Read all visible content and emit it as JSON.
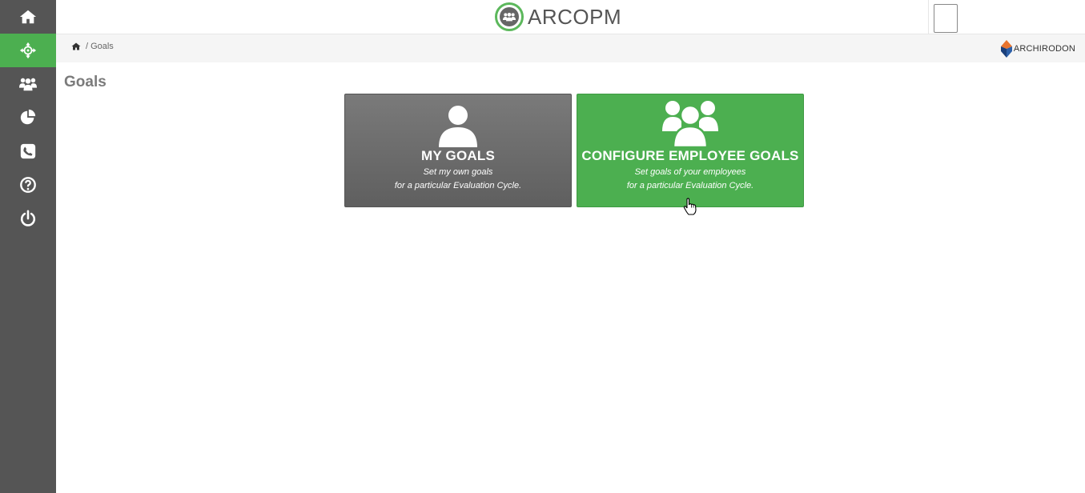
{
  "app": {
    "brand": "ARCOPM",
    "company": "ARCHIRODON"
  },
  "sidebar": {
    "items": [
      {
        "icon": "home-icon",
        "active": false
      },
      {
        "icon": "crosshair-icon",
        "active": true
      },
      {
        "icon": "users-icon",
        "active": false
      },
      {
        "icon": "pie-chart-icon",
        "active": false
      },
      {
        "icon": "phone-icon",
        "active": false
      },
      {
        "icon": "help-icon",
        "active": false
      },
      {
        "icon": "power-icon",
        "active": false
      }
    ]
  },
  "breadcrumb": {
    "separator": "/",
    "current": "Goals"
  },
  "page": {
    "title": "Goals"
  },
  "tiles": [
    {
      "title": "MY GOALS",
      "line1": "Set my own goals",
      "line2": "for a particular Evaluation Cycle.",
      "icon": "user-icon",
      "color": "#6b6b6b"
    },
    {
      "title": "CONFIGURE EMPLOYEE GOALS",
      "line1": "Set goals of your employees",
      "line2": "for a particular Evaluation Cycle.",
      "icon": "group-icon",
      "color": "#4caf50"
    }
  ],
  "colors": {
    "accent": "#4caf50",
    "sidebar": "#555555"
  }
}
